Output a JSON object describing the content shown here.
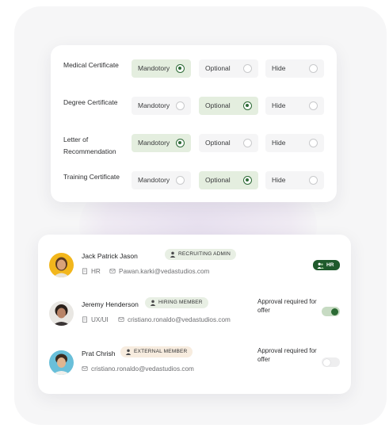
{
  "documents": [
    {
      "label": "Medical Certificate",
      "options": [
        "Mandotory",
        "Optional",
        "Hide"
      ],
      "selected": 0
    },
    {
      "label": "Degree Certificate",
      "options": [
        "Mandotory",
        "Optional",
        "Hide"
      ],
      "selected": 1
    },
    {
      "label": "Letter of Recommendation",
      "options": [
        "Mandotory",
        "Optional",
        "Hide"
      ],
      "selected": 0
    },
    {
      "label": "Training Certificate",
      "options": [
        "Mandotory",
        "Optional",
        "Hide"
      ],
      "selected": 1
    }
  ],
  "members": [
    {
      "name": "Jack Patrick Jason",
      "role": "RECRUITING ADMIN",
      "department": "HR",
      "email": "Pawan.karki@vedastudios.com",
      "hr_chip": "HR"
    },
    {
      "name": "Jeremy Henderson",
      "role": "HIRING MEMBER",
      "department": "UX/UI",
      "email": "cristiano.ronaldo@vedastudios.com",
      "approval_text": "Approval required for offer",
      "approval_on": true
    },
    {
      "name": "Prat Chrish",
      "role": "EXTERNAL MEMBER",
      "email": "cristiano.ronaldo@vedastudios.com",
      "approval_text": "Approval required for offer",
      "approval_on": false
    }
  ],
  "colors": {
    "accent": "#2c6a35",
    "selected_bg": "#e4eedf",
    "external_badge": "#f7ecdf",
    "hr_chip": "#1f5a2c"
  },
  "icons": [
    "person-icon",
    "building-icon",
    "mail-icon",
    "radio-icon",
    "toggle-icon"
  ]
}
